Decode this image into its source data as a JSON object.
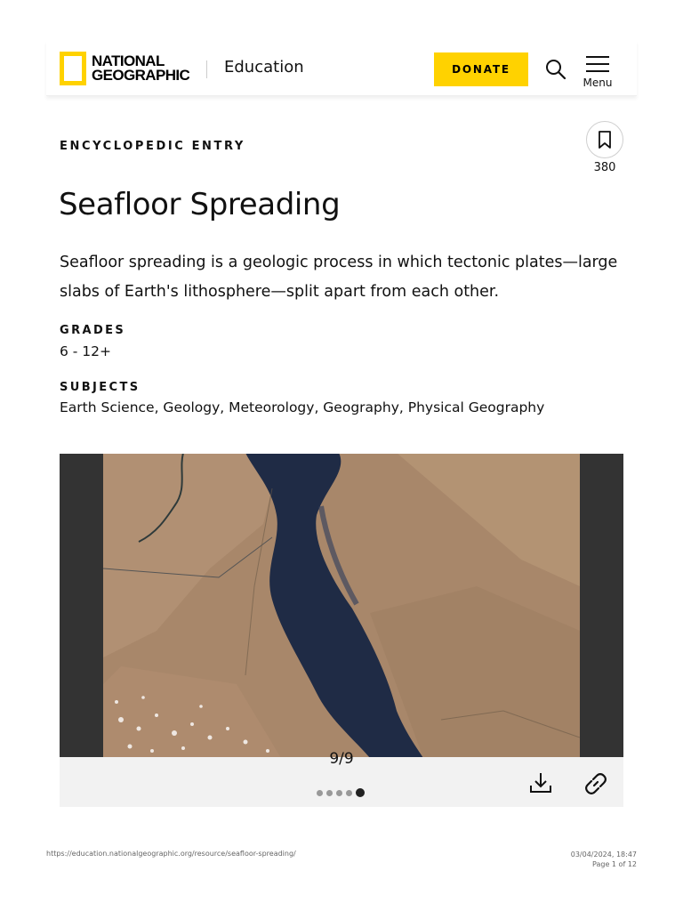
{
  "header": {
    "logo_line1": "NATIONAL",
    "logo_line2": "GEOGRAPHIC",
    "section": "Education",
    "donate_label": "DONATE",
    "menu_label": "Menu",
    "accent_color": "#ffd200"
  },
  "article": {
    "kicker": "ENCYCLOPEDIC ENTRY",
    "bookmark_count": "380",
    "title": "Seafloor Spreading",
    "lead": "Seafloor spreading is a geologic process in which tectonic plates—large slabs of Earth's lithosphere—split apart from each other.",
    "grades_label": "GRADES",
    "grades_value": "6 - 12+",
    "subjects_label": "SUBJECTS",
    "subjects_value": "Earth Science, Geology, Meteorology, Geography, Physical Geography"
  },
  "gallery": {
    "counter": "9/9",
    "current_slide": 9,
    "total_slides": 9,
    "icons": [
      "download-icon",
      "link-icon"
    ]
  },
  "footer": {
    "url": "https://education.nationalgeographic.org/resource/seafloor-spreading/",
    "datetime": "03/04/2024, 18:47",
    "page": "Page 1 of 12"
  }
}
